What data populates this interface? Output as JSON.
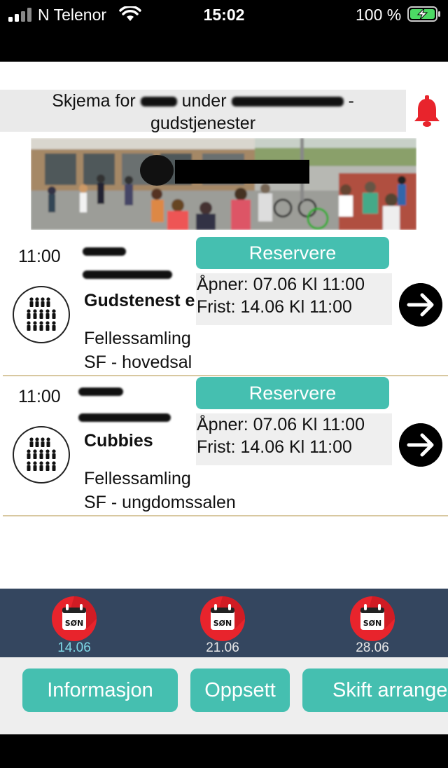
{
  "status_bar": {
    "carrier": "N Telenor",
    "time": "15:02",
    "battery": "100 %"
  },
  "header": {
    "title_prefix": "Skjema for",
    "title_middle": "under",
    "title_suffix": "-",
    "title_line2": "gudstjenester"
  },
  "events": [
    {
      "time": "11:00",
      "title": "Gudstenest e",
      "category": "Fellessamling",
      "location": "SF - hovedsal",
      "reserve_label": "Reservere",
      "opens": "Åpner: 07.06 Kl 11:00",
      "deadline": "Frist: 14.06 Kl 11:00"
    },
    {
      "time": "11:00",
      "title": "Cubbies",
      "category": "Fellessamling",
      "location": "SF - ungdomssalen",
      "reserve_label": "Reservere",
      "opens": "Åpner: 07.06 Kl 11:00",
      "deadline": "Frist: 14.06 Kl 11:00"
    }
  ],
  "days": [
    {
      "label": "SØN",
      "date": "14.06",
      "active": true
    },
    {
      "label": "SØN",
      "date": "21.06",
      "active": false
    },
    {
      "label": "SØN",
      "date": "28.06",
      "active": false
    }
  ],
  "buttons": {
    "info": "Informasjon",
    "setup": "Oppsett",
    "switch": "Skift arrangement"
  },
  "colors": {
    "accent": "#45bfb0",
    "date_bar": "#34465f",
    "bell": "#e8242c",
    "calendar_red": "#e8242c",
    "active_date": "#7fd8e6"
  },
  "icons": {
    "bell": "bell-icon",
    "go": "arrow-right-circle-icon",
    "group": "group-people-icon",
    "calendar": "calendar-icon"
  }
}
